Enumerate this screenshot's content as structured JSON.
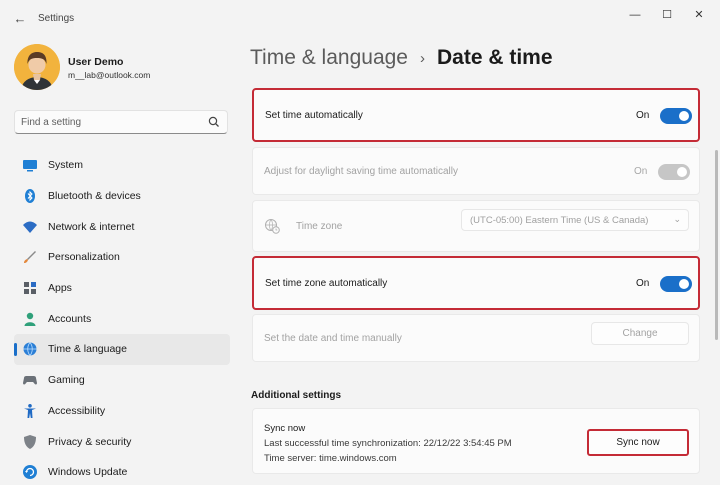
{
  "window": {
    "title": "Settings",
    "back_glyph": "←",
    "minimize_glyph": "—",
    "maximize_glyph": "☐",
    "close_glyph": "✕"
  },
  "user": {
    "name": "User Demo",
    "email": "m__lab@outlook.com"
  },
  "search": {
    "placeholder": "Find a setting",
    "icon": "search-icon"
  },
  "sidebar": {
    "items": [
      {
        "label": "System",
        "icon": "system-icon",
        "active": false
      },
      {
        "label": "Bluetooth & devices",
        "icon": "bluetooth-icon",
        "active": false
      },
      {
        "label": "Network & internet",
        "icon": "wifi-icon",
        "active": false
      },
      {
        "label": "Personalization",
        "icon": "brush-icon",
        "active": false
      },
      {
        "label": "Apps",
        "icon": "apps-icon",
        "active": false
      },
      {
        "label": "Accounts",
        "icon": "accounts-icon",
        "active": false
      },
      {
        "label": "Time & language",
        "icon": "globe-clock-icon",
        "active": true
      },
      {
        "label": "Gaming",
        "icon": "gamepad-icon",
        "active": false
      },
      {
        "label": "Accessibility",
        "icon": "accessibility-icon",
        "active": false
      },
      {
        "label": "Privacy & security",
        "icon": "shield-icon",
        "active": false
      },
      {
        "label": "Windows Update",
        "icon": "update-icon",
        "active": false
      }
    ]
  },
  "header": {
    "parent": "Time & language",
    "separator": "›",
    "current": "Date & time"
  },
  "settings": {
    "set_time_auto": {
      "label": "Set time automatically",
      "state": "On",
      "enabled": true
    },
    "daylight_saving": {
      "label": "Adjust for daylight saving time automatically",
      "state": "On",
      "enabled": false
    },
    "time_zone": {
      "label": "Time zone",
      "value": "(UTC-05:00) Eastern Time (US & Canada)",
      "chevron": "⌄",
      "enabled": false
    },
    "set_tz_auto": {
      "label": "Set time zone automatically",
      "state": "On",
      "enabled": true
    },
    "manual": {
      "label": "Set the date and time manually",
      "button": "Change",
      "enabled": false
    }
  },
  "additional": {
    "title": "Additional settings",
    "sync_title": "Sync now",
    "last_sync": "Last successful time synchronization: 22/12/22 3:54:45 PM",
    "server": "Time server: time.windows.com",
    "sync_button": "Sync now"
  },
  "colors": {
    "accent": "#1a6fc9",
    "highlight_border": "#c42b36"
  }
}
